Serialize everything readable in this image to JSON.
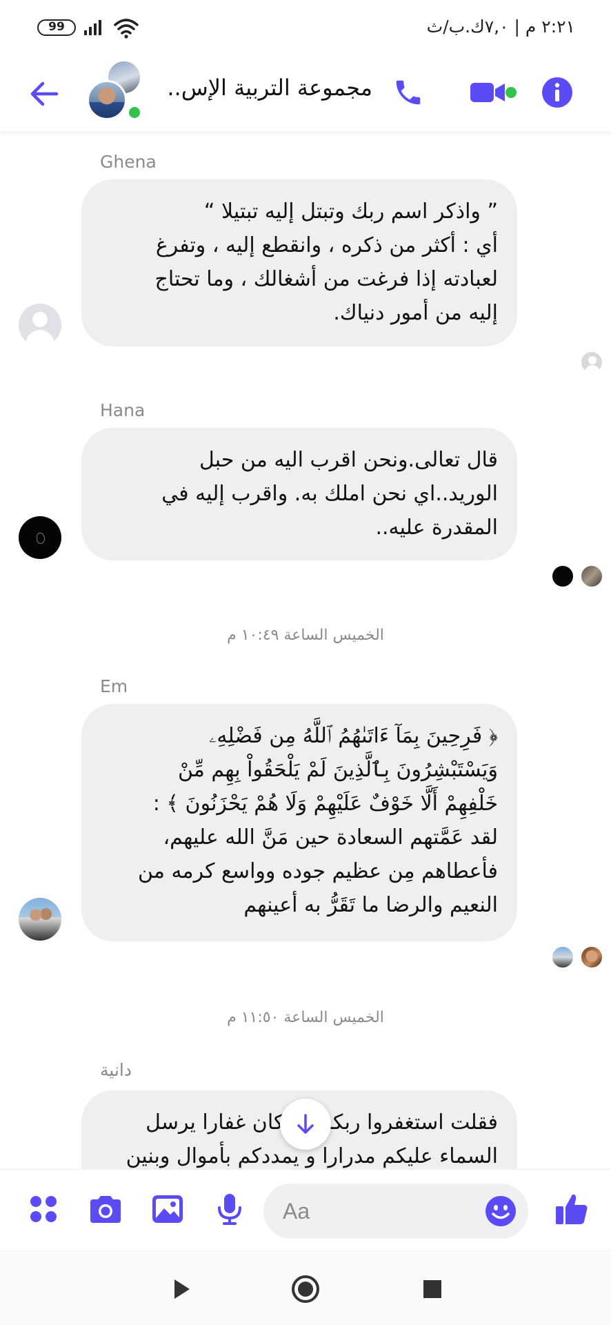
{
  "status_bar": {
    "time": "٢:٢١ م | ٧,٠ك.ب/ث",
    "battery": "99"
  },
  "header": {
    "title": "مجموعة التربية الإس..",
    "accent_color": "#5b4bf5",
    "online_color": "#31c24a"
  },
  "messages": [
    {
      "sender": "Ghena",
      "lines": [
        "” واذكر اسم ربك وتبتل إليه تبتيلا “",
        "أي : أكثر من ذكره ، وانقطع إليه ، وتفرغ",
        "لعبادته إذا فرغت من أشغالك ، وما تحتاج",
        "إليه من أمور دنياك."
      ],
      "avatar": "default-avatar",
      "read_receipts": [
        "default-avatar"
      ]
    },
    {
      "sender": "Hana",
      "lines": [
        "قال تعالى.ونحن اقرب اليه من حبل",
        "الوريد..اي نحن املك به. واقرب إليه في",
        "المقدرة عليه.."
      ],
      "avatar": "dark-avatar",
      "read_receipts": [
        "dark-avatar",
        "photo-avatar"
      ]
    },
    {
      "timestamp": "الخميس الساعة ١٠:٤٩ م"
    },
    {
      "sender": "Em",
      "lines": [
        "﴿ فَرِحِينَ بِمَآ ءَاتَىٰهُمُ ٱللَّهُ مِن فَضْلِهِۦ",
        "وَيَسْتَبْشِرُونَ بِٱلَّذِينَ لَمْ يَلْحَقُواْ بِهِم مِّنْ",
        "خَلْفِهِمْ أَلَّا خَوْفٌ عَلَيْهِمْ وَلَا هُمْ يَحْزَنُونَ ﴾ :",
        "لقد عَمَّتهم السعادة حين مَنَّ الله عليهم،",
        "فأعطاهم مِن عظيم جوده وواسع كرمه من",
        "النعيم والرضا ما تَقَرُّ به أعينهم"
      ],
      "avatar": "photo-avatar",
      "read_receipts": [
        "photo-avatar",
        "photo-avatar"
      ]
    },
    {
      "timestamp": "الخميس الساعة ١١:٥٠ م"
    },
    {
      "sender": "دانية",
      "lines": [
        "فقلت استغفروا ربكم إنه كان غفارا يرسل",
        "السماء عليكم مدرارا و يمددكم بأموال وبنين"
      ]
    }
  ],
  "composer": {
    "placeholder": "Aa",
    "icons": [
      "apps-icon",
      "camera-icon",
      "gallery-icon",
      "microphone-icon",
      "emoji-icon",
      "like-icon"
    ]
  },
  "nav": {
    "icons": [
      "back-triangle-icon",
      "home-circle-icon",
      "recents-square-icon"
    ]
  }
}
